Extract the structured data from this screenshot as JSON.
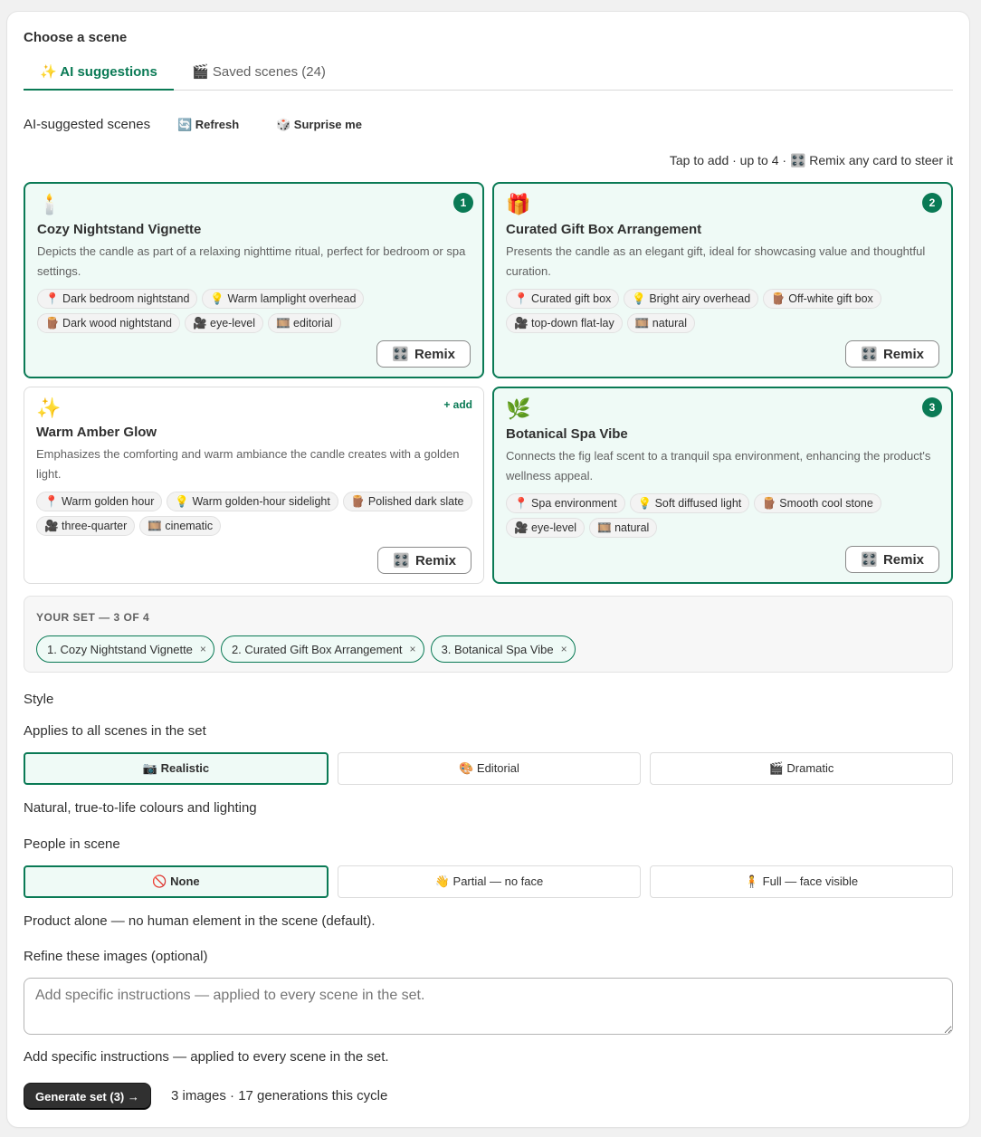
{
  "heading": "Choose a scene",
  "tabs": [
    {
      "label": "✨ AI suggestions",
      "active": true
    },
    {
      "label": "🎬 Saved scenes (24)",
      "active": false
    }
  ],
  "suggestions": {
    "label": "AI-suggested scenes",
    "refresh_label": "🔄 Refresh",
    "surprise_label": "🎲 Surprise me",
    "hint": "Tap to add · up to 4 · 🎛️ Remix any card to steer it"
  },
  "cards": [
    {
      "emoji": "🕯️",
      "title": "Cozy Nightstand Vignette",
      "desc": "Depicts the candle as part of a relaxing nighttime ritual, perfect for bedroom or spa settings.",
      "badge": "1",
      "selected": true,
      "chips": [
        "📍 Dark bedroom nightstand",
        "💡 Warm lamplight overhead",
        "🪵 Dark wood nightstand",
        "🎥 eye-level",
        "🎞️ editorial"
      ],
      "remix_label": "Remix"
    },
    {
      "emoji": "🎁",
      "title": "Curated Gift Box Arrangement",
      "desc": "Presents the candle as an elegant gift, ideal for showcasing value and thoughtful curation.",
      "badge": "2",
      "selected": true,
      "chips": [
        "📍 Curated gift box",
        "💡 Bright airy overhead",
        "🪵 Off-white gift box",
        "🎥 top-down flat-lay",
        "🎞️ natural"
      ],
      "remix_label": "Remix"
    },
    {
      "emoji": "✨",
      "title": "Warm Amber Glow",
      "desc": "Emphasizes the comforting and warm ambiance the candle creates with a golden light.",
      "add_label": "+ add",
      "selected": false,
      "chips": [
        "📍 Warm golden hour",
        "💡 Warm golden-hour sidelight",
        "🪵 Polished dark slate",
        "🎥 three-quarter",
        "🎞️ cinematic"
      ],
      "remix_label": "Remix"
    },
    {
      "emoji": "🌿",
      "title": "Botanical Spa Vibe",
      "desc": "Connects the fig leaf scent to a tranquil spa environment, enhancing the product's wellness appeal.",
      "badge": "3",
      "selected": true,
      "chips": [
        "📍 Spa environment",
        "💡 Soft diffused light",
        "🪵 Smooth cool stone",
        "🎥 eye-level",
        "🎞️ natural"
      ],
      "remix_label": "Remix"
    }
  ],
  "your_set": {
    "title": "YOUR SET — 3 OF 4",
    "items": [
      "1. Cozy Nightstand Vignette",
      "2. Curated Gift Box Arrangement",
      "3. Botanical Spa Vibe"
    ],
    "remove_glyph": "×"
  },
  "style": {
    "label": "Style",
    "sub": "Applies to all scenes in the set",
    "options": [
      "📷 Realistic",
      "🎨 Editorial",
      "🎬 Dramatic"
    ],
    "selected": "📷 Realistic",
    "description": "Natural, true-to-life colours and lighting"
  },
  "people": {
    "label": "People in scene",
    "options": [
      "🚫 None",
      "👋 Partial — no face",
      "🧍 Full — face visible"
    ],
    "selected": "🚫 None",
    "description": "Product alone — no human element in the scene (default)."
  },
  "refine": {
    "label": "Refine these images (optional)",
    "placeholder": "Add specific instructions — applied to every scene in the set.",
    "helper": "Add specific instructions — applied to every scene in the set."
  },
  "generate": {
    "button_label": "Generate set (3) →",
    "note": "3 images · 17 generations this cycle"
  },
  "colors": {
    "accent": "#0a7a55",
    "selected_bg": "#effaf6"
  }
}
